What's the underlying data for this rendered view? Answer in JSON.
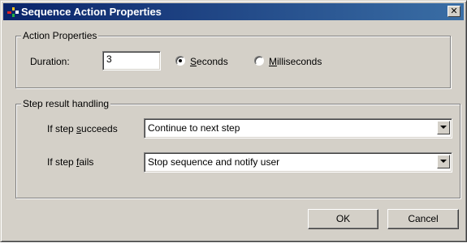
{
  "window": {
    "title": "Sequence Action Properties",
    "close_glyph": "✕",
    "title_bar_color": "#0a246a",
    "face_color": "#d4d0c8",
    "icon": "sequence-app-icon"
  },
  "action_properties": {
    "group_label": "Action Properties",
    "duration_label": "Duration:",
    "duration_value": "3",
    "unit_options": [
      {
        "label_mnemonic": "S",
        "label_rest": "econds",
        "selected": true
      },
      {
        "label_mnemonic": "M",
        "label_rest": "illiseconds",
        "selected": false
      }
    ]
  },
  "step_result_handling": {
    "group_label": "Step result handling",
    "succeeds": {
      "label_pre": "If step ",
      "label_mnemonic": "s",
      "label_post": "ucceeds",
      "value": "Continue to next step"
    },
    "fails": {
      "label_pre": "If step ",
      "label_mnemonic": "f",
      "label_post": "ails",
      "value": "Stop sequence and notify user"
    }
  },
  "buttons": {
    "ok": "OK",
    "cancel": "Cancel"
  }
}
